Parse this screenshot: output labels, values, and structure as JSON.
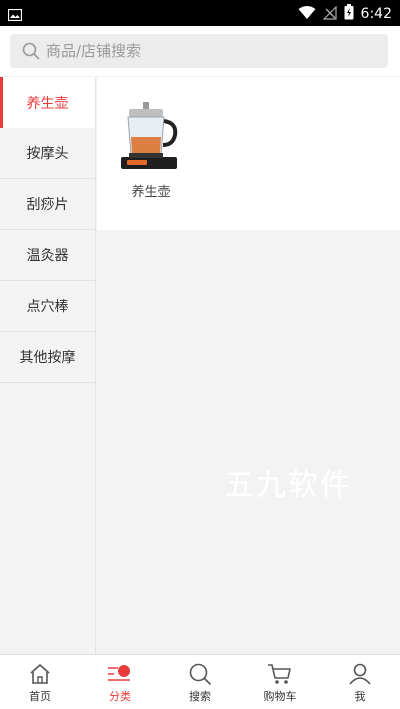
{
  "status_bar": {
    "time": "6:42"
  },
  "search": {
    "placeholder": "商品/店铺搜索"
  },
  "sidebar": {
    "items": [
      {
        "label": "养生壶",
        "active": true
      },
      {
        "label": "按摩头",
        "active": false
      },
      {
        "label": "刮痧片",
        "active": false
      },
      {
        "label": "温灸器",
        "active": false
      },
      {
        "label": "点穴棒",
        "active": false
      },
      {
        "label": "其他按摩",
        "active": false
      }
    ]
  },
  "products": [
    {
      "label": "养生壶",
      "icon": "kettle-image"
    }
  ],
  "watermark": "五九软件",
  "tabbar": {
    "items": [
      {
        "label": "首页",
        "icon": "home-icon",
        "active": false
      },
      {
        "label": "分类",
        "icon": "category-icon",
        "active": true
      },
      {
        "label": "搜索",
        "icon": "search-icon",
        "active": false
      },
      {
        "label": "购物车",
        "icon": "cart-icon",
        "active": false
      },
      {
        "label": "我",
        "icon": "user-icon",
        "active": false
      }
    ]
  },
  "colors": {
    "accent": "#e83b3b",
    "background": "#f3f3f3",
    "search_bg": "#ececec"
  }
}
